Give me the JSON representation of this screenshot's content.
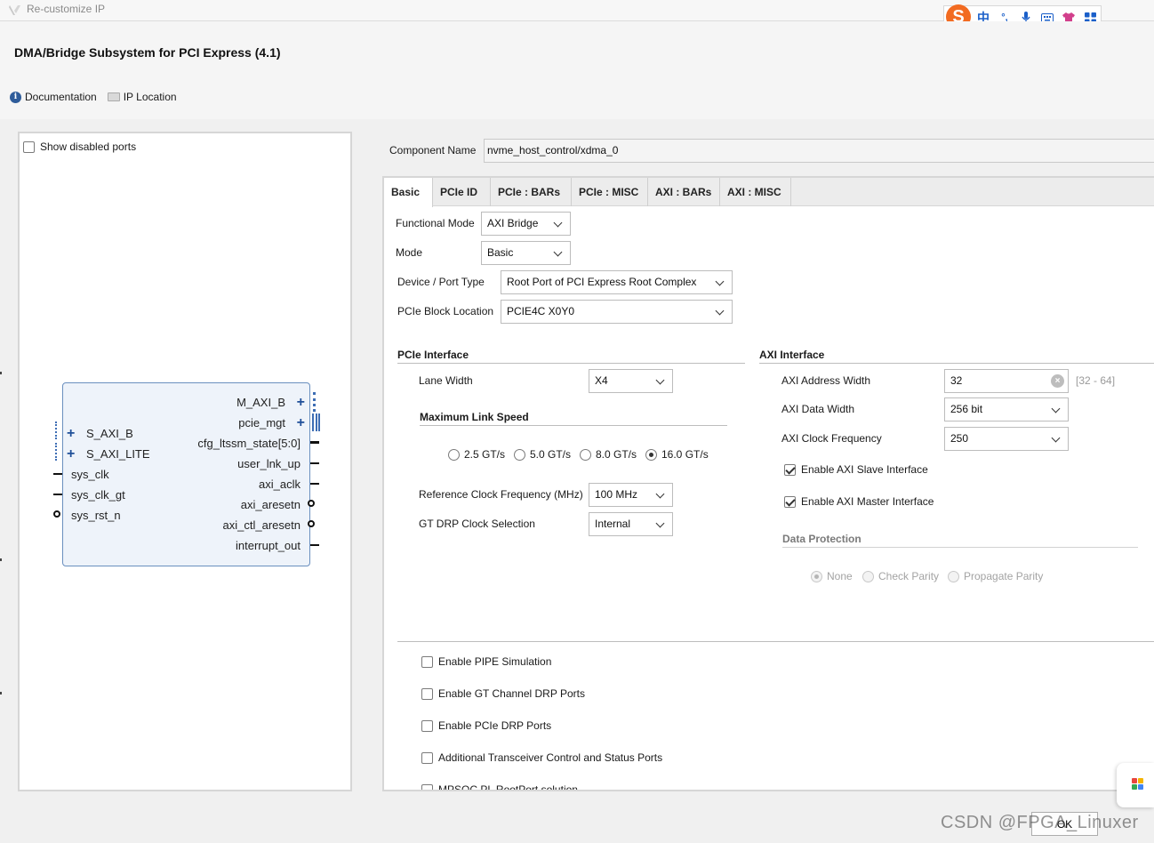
{
  "window": {
    "title": "Re-customize IP"
  },
  "ime": {
    "logo": "S",
    "items": [
      "中",
      "°,",
      "mic-icon",
      "keyboard-icon",
      "shirt-icon",
      "grid-icon"
    ]
  },
  "header": {
    "heading": "DMA/Bridge Subsystem for PCI Express (4.1)",
    "documentation_label": "Documentation",
    "ip_location_label": "IP Location"
  },
  "symbol": {
    "show_disabled_ports": "Show disabled ports",
    "left_ports": [
      "S_AXI_B",
      "S_AXI_LITE",
      "sys_clk",
      "sys_clk_gt",
      "sys_rst_n"
    ],
    "right_ports": [
      "M_AXI_B",
      "pcie_mgt",
      "cfg_ltssm_state[5:0]",
      "user_lnk_up",
      "axi_aclk",
      "axi_aresetn",
      "axi_ctl_aresetn",
      "interrupt_out"
    ]
  },
  "component": {
    "label": "Component Name",
    "value": "nvme_host_control/xdma_0"
  },
  "tabs": [
    "Basic",
    "PCIe ID",
    "PCIe : BARs",
    "PCIe : MISC",
    "AXI : BARs",
    "AXI : MISC"
  ],
  "basic": {
    "functional_mode": {
      "label": "Functional Mode",
      "value": "AXI Bridge"
    },
    "mode": {
      "label": "Mode",
      "value": "Basic"
    },
    "device_port_type": {
      "label": "Device / Port Type",
      "value": "Root Port of PCI Express Root Complex"
    },
    "pcie_block_location": {
      "label": "PCIe Block Location",
      "value": "PCIE4C X0Y0"
    }
  },
  "pcie_interface": {
    "title": "PCIe Interface",
    "lane_width": {
      "label": "Lane Width",
      "value": "X4"
    },
    "max_link_speed": {
      "title": "Maximum Link Speed",
      "options": [
        "2.5 GT/s",
        "5.0 GT/s",
        "8.0 GT/s",
        "16.0 GT/s"
      ],
      "selected": "16.0 GT/s"
    },
    "ref_clock": {
      "label": "Reference Clock Frequency (MHz)",
      "value": "100 MHz"
    },
    "gt_drp_clock": {
      "label": "GT DRP Clock Selection",
      "value": "Internal"
    }
  },
  "axi_interface": {
    "title": "AXI Interface",
    "address_width": {
      "label": "AXI Address Width",
      "value": "32",
      "range": "[32 - 64]"
    },
    "data_width": {
      "label": "AXI Data Width",
      "value": "256 bit"
    },
    "clock_frequency": {
      "label": "AXI Clock Frequency",
      "value": "250"
    },
    "enable_slave": {
      "label": "Enable AXI Slave Interface",
      "checked": true
    },
    "enable_master": {
      "label": "Enable AXI Master Interface",
      "checked": true
    },
    "data_protection": {
      "title": "Data Protection",
      "options": [
        "None",
        "Check Parity",
        "Propagate Parity"
      ],
      "selected": "None"
    }
  },
  "options": {
    "items": [
      "Enable PIPE Simulation",
      "Enable GT Channel DRP Ports",
      "Enable PCIe DRP Ports",
      "Additional Transceiver Control and Status Ports",
      "MPSOC PL RootPort solution"
    ]
  },
  "footer": {
    "ok_label": "OK",
    "watermark": "CSDN @FPGA_Linuxer"
  }
}
